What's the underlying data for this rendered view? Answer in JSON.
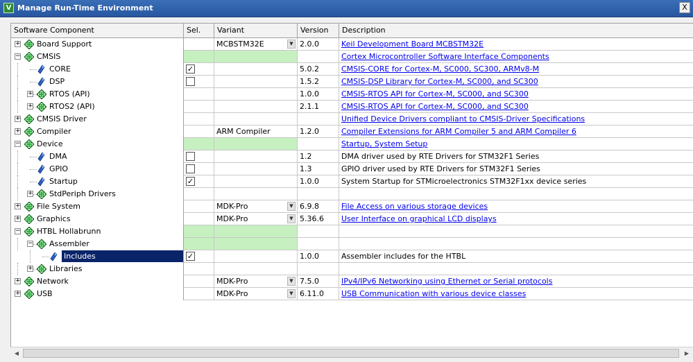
{
  "window": {
    "title": "Manage Run-Time Environment",
    "close_label": "X",
    "app_icon": "V"
  },
  "columns": [
    "Software Component",
    "Sel.",
    "Variant",
    "Version",
    "Description"
  ],
  "colors": {
    "green_cell": "#c6f0c0",
    "link": "#0000ee",
    "selection": "#0a246a",
    "titlebar": "#2757a0"
  },
  "rows": [
    {
      "name": "Board Support",
      "level": 0,
      "icon": "component-bundle-icon",
      "expander": "+",
      "sel": "none",
      "variant": "MCBSTM32E",
      "dropdown": true,
      "version": "2.0.0",
      "desc": "Keil Development Board MCBSTM32E",
      "link": true,
      "green": false
    },
    {
      "name": "CMSIS",
      "level": 0,
      "icon": "component-bundle-icon",
      "expander": "-",
      "sel": "green",
      "variant": "",
      "dropdown": false,
      "version": "",
      "desc": "Cortex Microcontroller Software Interface Components",
      "link": true,
      "green": true
    },
    {
      "name": "CORE",
      "level": 1,
      "icon": "component-gem-icon",
      "expander": "",
      "sel": "checked",
      "variant": "",
      "dropdown": false,
      "version": "5.0.2",
      "desc": "CMSIS-CORE for Cortex-M, SC000, SC300, ARMv8-M",
      "link": true,
      "green": false
    },
    {
      "name": "DSP",
      "level": 1,
      "icon": "component-gem-icon",
      "expander": "",
      "sel": "unchecked",
      "variant": "",
      "dropdown": false,
      "version": "1.5.2",
      "desc": "CMSIS-DSP Library for Cortex-M, SC000, and SC300",
      "link": true,
      "green": false
    },
    {
      "name": "RTOS (API)",
      "level": 1,
      "icon": "component-bundle-icon",
      "expander": "+",
      "sel": "none",
      "variant": "",
      "dropdown": false,
      "version": "1.0.0",
      "desc": "CMSIS-RTOS API for Cortex-M, SC000, and SC300",
      "link": true,
      "green": false
    },
    {
      "name": "RTOS2 (API)",
      "level": 1,
      "icon": "component-bundle-icon",
      "expander": "+",
      "sel": "none",
      "variant": "",
      "dropdown": false,
      "version": "2.1.1",
      "desc": "CMSIS-RTOS API for Cortex-M, SC000, and SC300",
      "link": true,
      "green": false
    },
    {
      "name": "CMSIS Driver",
      "level": 0,
      "icon": "component-bundle-icon",
      "expander": "+",
      "sel": "none",
      "variant": "",
      "dropdown": false,
      "version": "",
      "desc": "Unified Device Drivers compliant to CMSIS-Driver Specifications",
      "link": true,
      "green": false
    },
    {
      "name": "Compiler",
      "level": 0,
      "icon": "component-bundle-icon",
      "expander": "+",
      "sel": "none",
      "variant": "ARM Compiler",
      "dropdown": false,
      "version": "1.2.0",
      "desc": "Compiler Extensions for ARM Compiler 5 and ARM Compiler 6",
      "link": true,
      "green": false
    },
    {
      "name": "Device",
      "level": 0,
      "icon": "component-bundle-icon",
      "expander": "-",
      "sel": "green",
      "variant": "",
      "dropdown": false,
      "version": "",
      "desc": "Startup, System Setup",
      "link": true,
      "green": true
    },
    {
      "name": "DMA",
      "level": 1,
      "icon": "component-gem-icon",
      "expander": "",
      "sel": "unchecked",
      "variant": "",
      "dropdown": false,
      "version": "1.2",
      "desc": "DMA driver used by RTE Drivers for STM32F1 Series",
      "link": false,
      "green": false
    },
    {
      "name": "GPIO",
      "level": 1,
      "icon": "component-gem-icon",
      "expander": "",
      "sel": "unchecked",
      "variant": "",
      "dropdown": false,
      "version": "1.3",
      "desc": "GPIO driver used by RTE Drivers for STM32F1 Series",
      "link": false,
      "green": false
    },
    {
      "name": "Startup",
      "level": 1,
      "icon": "component-gem-icon",
      "expander": "",
      "sel": "checked",
      "variant": "",
      "dropdown": false,
      "version": "1.0.0",
      "desc": "System Startup for STMicroelectronics STM32F1xx device series",
      "link": false,
      "green": false
    },
    {
      "name": "StdPeriph Drivers",
      "level": 1,
      "icon": "component-bundle-icon",
      "expander": "+",
      "sel": "none",
      "variant": "",
      "dropdown": false,
      "version": "",
      "desc": "",
      "link": false,
      "green": false
    },
    {
      "name": "File System",
      "level": 0,
      "icon": "component-bundle-icon",
      "expander": "+",
      "sel": "none",
      "variant": "MDK-Pro",
      "dropdown": true,
      "version": "6.9.8",
      "desc": "File Access on various storage devices",
      "link": true,
      "green": false
    },
    {
      "name": "Graphics",
      "level": 0,
      "icon": "component-bundle-icon",
      "expander": "+",
      "sel": "none",
      "variant": "MDK-Pro",
      "dropdown": true,
      "version": "5.36.6",
      "desc": "User Interface on graphical LCD displays",
      "link": true,
      "green": false
    },
    {
      "name": "HTBL Hollabrunn",
      "level": 0,
      "icon": "component-bundle-icon",
      "expander": "-",
      "sel": "green",
      "variant": "",
      "dropdown": false,
      "version": "",
      "desc": "",
      "link": false,
      "green": true
    },
    {
      "name": "Assembler",
      "level": 1,
      "icon": "component-bundle-icon",
      "expander": "-",
      "sel": "green",
      "variant": "",
      "dropdown": false,
      "version": "",
      "desc": "",
      "link": false,
      "green": true
    },
    {
      "name": "Includes",
      "level": 2,
      "icon": "component-gem-icon",
      "expander": "",
      "sel": "checked",
      "variant": "",
      "dropdown": false,
      "version": "1.0.0",
      "desc": "Assembler includes for the HTBL",
      "link": false,
      "green": false,
      "selected": true
    },
    {
      "name": "Libraries",
      "level": 1,
      "icon": "component-bundle-icon",
      "expander": "+",
      "sel": "none",
      "variant": "",
      "dropdown": false,
      "version": "",
      "desc": "",
      "link": false,
      "green": false
    },
    {
      "name": "Network",
      "level": 0,
      "icon": "component-bundle-icon",
      "expander": "+",
      "sel": "none",
      "variant": "MDK-Pro",
      "dropdown": true,
      "version": "7.5.0",
      "desc": "IPv4/IPv6 Networking using Ethernet or Serial protocols",
      "link": true,
      "green": false
    },
    {
      "name": "USB",
      "level": 0,
      "icon": "component-bundle-icon",
      "expander": "+",
      "sel": "none",
      "variant": "MDK-Pro",
      "dropdown": true,
      "version": "6.11.0",
      "desc": "USB Communication with various device classes",
      "link": true,
      "green": false
    }
  ]
}
